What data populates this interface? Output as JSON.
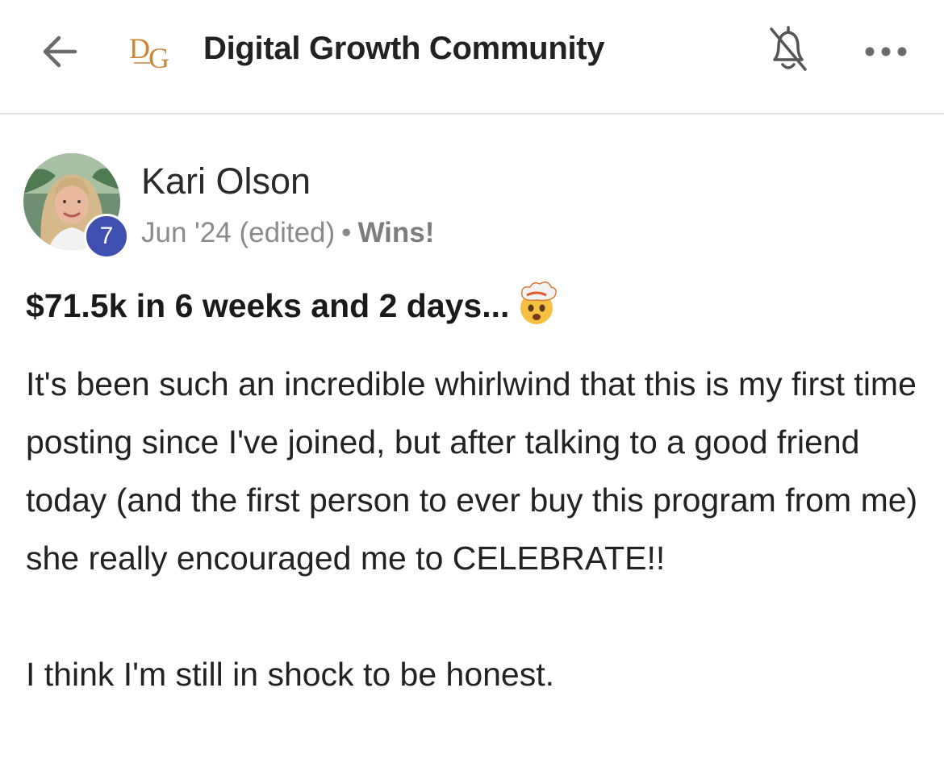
{
  "header": {
    "title": "Digital Growth Community",
    "logo_text": "DG",
    "icons": {
      "back": "arrow-left-icon",
      "bell": "bell-off-icon",
      "more": "more-horizontal-icon"
    }
  },
  "post": {
    "author": {
      "name": "Kari Olson",
      "level": "7"
    },
    "date": "Jun '24 (edited)",
    "separator": "•",
    "category": "Wins!",
    "title": "$71.5k in 6 weeks and 2 days...",
    "title_emoji": "exploding-head-emoji",
    "paragraphs": [
      "It's been such an incredible whirlwind that this is my first time posting since I've joined, but after talking to a good friend today (and the first person to ever buy this program from me) she really encouraged me to CELEBRATE!!",
      "I think I'm still in shock to be honest."
    ]
  },
  "colors": {
    "level_badge": "#3e4fb0",
    "logo_gold": "#c9873a",
    "text": "#222222",
    "muted": "#8a8a8a"
  }
}
